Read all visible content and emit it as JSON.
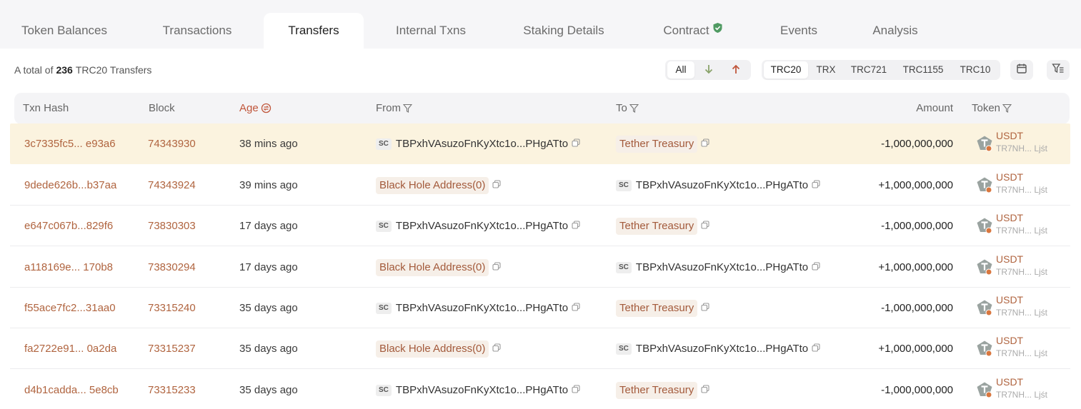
{
  "tabs": [
    {
      "label": "Token Balances"
    },
    {
      "label": "Transactions"
    },
    {
      "label": "Transfers"
    },
    {
      "label": "Internal Txns"
    },
    {
      "label": "Staking Details"
    },
    {
      "label": "Contract"
    },
    {
      "label": "Events"
    },
    {
      "label": "Analysis"
    }
  ],
  "summary": {
    "prefix": "A total of",
    "count": "236",
    "suffix": "TRC20 Transfers"
  },
  "direction_filter": {
    "all": "All",
    "in_icon": "arrow-down-icon",
    "out_icon": "arrow-up-icon"
  },
  "type_filter": [
    "TRC20",
    "TRX",
    "TRC721",
    "TRC1155",
    "TRC10"
  ],
  "columns": {
    "hash": "Txn Hash",
    "block": "Block",
    "age": "Age",
    "from": "From",
    "to": "To",
    "amount": "Amount",
    "token": "Token"
  },
  "sc_label": "SC",
  "rows": [
    {
      "hash": "3c7335fc5... e93a6",
      "block": "74343930",
      "age": "38 mins ago",
      "from": "TBPxhVAsuzoFnKyXtc1o...PHgATto",
      "to": "Tether Treasury",
      "amount": "-1,000,000,000",
      "token": "USDT",
      "token_addr": "TR7NH... Ljśt"
    },
    {
      "hash": "9dede626b...b37aa",
      "block": "74343924",
      "age": "39 mins ago",
      "from": "Black Hole Address(0)",
      "to": "TBPxhVAsuzoFnKyXtc1o...PHgATto",
      "amount": "+1,000,000,000",
      "token": "USDT",
      "token_addr": "TR7NH... Ljśt"
    },
    {
      "hash": "e647c067b...829f6",
      "block": "73830303",
      "age": "17 days ago",
      "from": "TBPxhVAsuzoFnKyXtc1o...PHgATto",
      "to": "Tether Treasury",
      "amount": "-1,000,000,000",
      "token": "USDT",
      "token_addr": "TR7NH... Ljśt"
    },
    {
      "hash": "a118169e... 170b8",
      "block": "73830294",
      "age": "17 days ago",
      "from": "Black Hole Address(0)",
      "to": "TBPxhVAsuzoFnKyXtc1o...PHgATto",
      "amount": "+1,000,000,000",
      "token": "USDT",
      "token_addr": "TR7NH... Ljśt"
    },
    {
      "hash": "f55ace7fc2...31aa0",
      "block": "73315240",
      "age": "35 days ago",
      "from": "TBPxhVAsuzoFnKyXtc1o...PHgATto",
      "to": "Tether Treasury",
      "amount": "-1,000,000,000",
      "token": "USDT",
      "token_addr": "TR7NH... Ljśt"
    },
    {
      "hash": "fa2722e91... 0a2da",
      "block": "73315237",
      "age": "35 days ago",
      "from": "Black Hole Address(0)",
      "to": "TBPxhVAsuzoFnKyXtc1o...PHgATto",
      "amount": "+1,000,000,000",
      "token": "USDT",
      "token_addr": "TR7NH... Ljśt"
    },
    {
      "hash": "d4b1cadda... 5e8cb",
      "block": "73315233",
      "age": "35 days ago",
      "from": "TBPxhVAsuzoFnKyXtc1o...PHgATto",
      "to": "Tether Treasury",
      "amount": "-1,000,000,000",
      "token": "USDT",
      "token_addr": "TR7NH... Ljśt"
    }
  ]
}
